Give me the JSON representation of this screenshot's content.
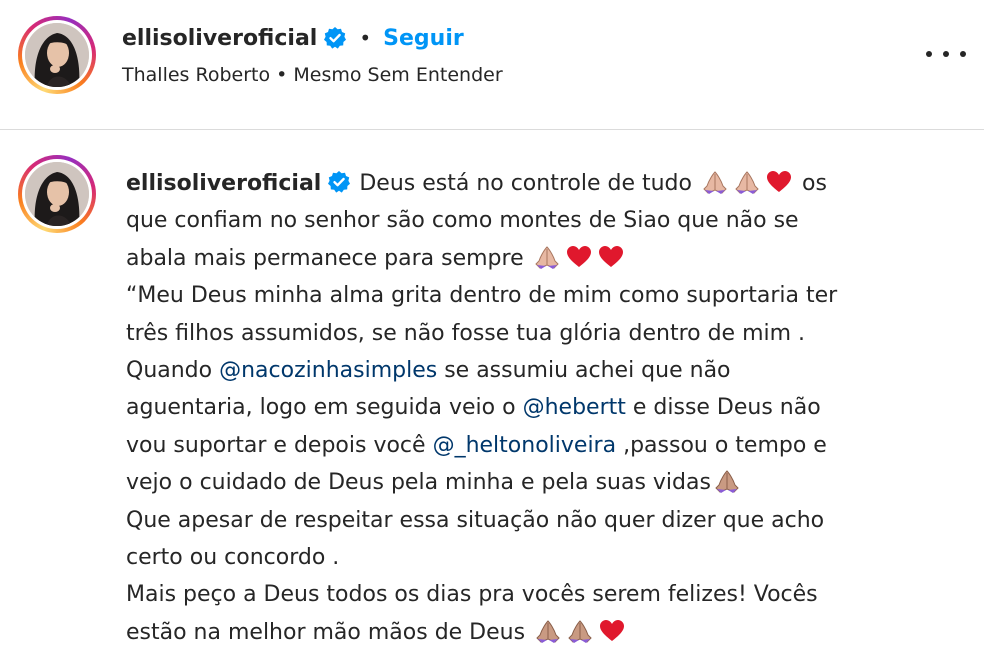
{
  "post": {
    "username": "ellisoliveroficial",
    "separator": "•",
    "follow_label": "Seguir",
    "audio_artist": "Thalles Roberto",
    "audio_separator": "•",
    "audio_title": "Mesmo Sem Entender"
  },
  "caption": {
    "username": "ellisoliveroficial",
    "l1_text": "Deus está no controle de tudo",
    "l1_tail": "os",
    "l2": "que confiam no senhor são como montes de Siao que não se",
    "l3_text": "abala mais permanece para sempre",
    "l4": "“Meu Deus minha alma grita dentro de mim como suportaria ter",
    "l5": "três filhos assumidos, se não fosse tua glória dentro de mim .",
    "l6_a": "Quando",
    "mention1": "@nacozinhasimples",
    "l6_b": "se assumiu achei que não",
    "l7_a": "aguentaria, logo em seguida veio o",
    "mention2": "@hebertt",
    "l7_b": "e disse Deus não",
    "l8_a": "vou suportar e depois você",
    "mention3": "@_heltonoliveira",
    "l8_b": ",passou o tempo e",
    "l9_text": "vejo o cuidado de Deus pela minha e pela suas vidas",
    "l10": "Que apesar de respeitar essa situação não quer dizer que acho",
    "l11": "certo ou concordo .",
    "l12": "Mais peço a Deus todos os dias pra vocês serem felizes! Vocês",
    "l13_text": "estão na melhor mão mãos de Deus"
  },
  "icons": {
    "verified": "verified-badge-icon",
    "more": "more-options-icon",
    "pray": "folded-hands-emoji",
    "heart": "red-heart-emoji"
  },
  "colors": {
    "accent": "#0095f6",
    "verified": "#0095f6",
    "mention": "#00376b",
    "heart": "#e0182d",
    "text": "#262626"
  }
}
